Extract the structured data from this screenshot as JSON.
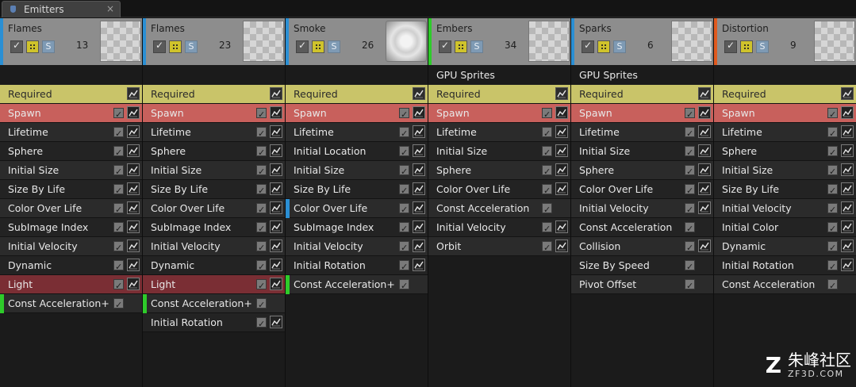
{
  "tab": {
    "title": "Emitters",
    "close_glyph": "×",
    "icon": "emitter-icon"
  },
  "colors": {
    "required": "#c9c469",
    "spawn": "#c8605c",
    "light": "#7a2e34",
    "enabled_marker": "#2ecb2a",
    "selected_marker": "#2a8fd4",
    "emitter_accent_blue": "#2a8fd4",
    "emitter_accent_green": "#2ecb2a",
    "emitter_accent_orange": "#e05a1f"
  },
  "emitters": [
    {
      "name": "Flames",
      "count": "13",
      "thumbnail": "checker",
      "accent": "blue",
      "subheader": "",
      "modules": [
        {
          "label": "Required",
          "type": "required"
        },
        {
          "label": "Spawn",
          "type": "spawn"
        },
        {
          "label": "Lifetime"
        },
        {
          "label": "Sphere"
        },
        {
          "label": "Initial Size"
        },
        {
          "label": "Size By Life"
        },
        {
          "label": "Color Over Life"
        },
        {
          "label": "SubImage Index"
        },
        {
          "label": "Initial Velocity"
        },
        {
          "label": "Dynamic"
        },
        {
          "label": "Light",
          "type": "light"
        },
        {
          "label": "Const Acceleration+",
          "marker": "green",
          "no_graph": true
        }
      ]
    },
    {
      "name": "Flames",
      "count": "23",
      "thumbnail": "checker",
      "accent": "blue",
      "subheader": "",
      "modules": [
        {
          "label": "Required",
          "type": "required"
        },
        {
          "label": "Spawn",
          "type": "spawn"
        },
        {
          "label": "Lifetime"
        },
        {
          "label": "Sphere"
        },
        {
          "label": "Initial Size"
        },
        {
          "label": "Size By Life"
        },
        {
          "label": "Color Over Life"
        },
        {
          "label": "SubImage Index"
        },
        {
          "label": "Initial Velocity"
        },
        {
          "label": "Dynamic"
        },
        {
          "label": "Light",
          "type": "light"
        },
        {
          "label": "Const Acceleration+",
          "marker": "green",
          "no_graph": true
        },
        {
          "label": "Initial Rotation"
        }
      ]
    },
    {
      "name": "Smoke",
      "count": "26",
      "thumbnail": "smoke",
      "accent": "blue",
      "subheader": "",
      "modules": [
        {
          "label": "Required",
          "type": "required"
        },
        {
          "label": "Spawn",
          "type": "spawn"
        },
        {
          "label": "Lifetime"
        },
        {
          "label": "Initial Location"
        },
        {
          "label": "Initial Size"
        },
        {
          "label": "Size By Life"
        },
        {
          "label": "Color Over Life",
          "marker": "blue"
        },
        {
          "label": "SubImage Index"
        },
        {
          "label": "Initial Velocity"
        },
        {
          "label": "Initial Rotation"
        },
        {
          "label": "Const Acceleration+",
          "marker": "green",
          "no_graph": true
        }
      ]
    },
    {
      "name": "Embers",
      "count": "34",
      "thumbnail": "checker",
      "accent": "green",
      "subheader": "GPU Sprites",
      "modules": [
        {
          "label": "Required",
          "type": "required"
        },
        {
          "label": "Spawn",
          "type": "spawn"
        },
        {
          "label": "Lifetime"
        },
        {
          "label": "Initial Size"
        },
        {
          "label": "Sphere"
        },
        {
          "label": "Color Over Life"
        },
        {
          "label": "Const Acceleration",
          "no_graph": true
        },
        {
          "label": "Initial Velocity"
        },
        {
          "label": "Orbit"
        }
      ]
    },
    {
      "name": "Sparks",
      "count": "6",
      "thumbnail": "checker",
      "accent": "blue",
      "subheader": "GPU Sprites",
      "modules": [
        {
          "label": "Required",
          "type": "required"
        },
        {
          "label": "Spawn",
          "type": "spawn"
        },
        {
          "label": "Lifetime"
        },
        {
          "label": "Initial Size"
        },
        {
          "label": "Sphere"
        },
        {
          "label": "Color Over Life"
        },
        {
          "label": "Initial Velocity"
        },
        {
          "label": "Const Acceleration",
          "no_graph": true
        },
        {
          "label": "Collision"
        },
        {
          "label": "Size By Speed",
          "no_graph": true
        },
        {
          "label": "Pivot Offset",
          "no_graph": true
        }
      ]
    },
    {
      "name": "Distortion",
      "count": "9",
      "thumbnail": "checker",
      "accent": "orange",
      "subheader": "",
      "modules": [
        {
          "label": "Required",
          "type": "required"
        },
        {
          "label": "Spawn",
          "type": "spawn"
        },
        {
          "label": "Lifetime"
        },
        {
          "label": "Sphere"
        },
        {
          "label": "Initial Size"
        },
        {
          "label": "Size By Life"
        },
        {
          "label": "Initial Velocity"
        },
        {
          "label": "Initial Color"
        },
        {
          "label": "Dynamic"
        },
        {
          "label": "Initial Rotation"
        },
        {
          "label": "Const Acceleration",
          "no_graph": true
        }
      ]
    }
  ],
  "watermark": {
    "logo": "Z",
    "text_cn": "朱峰社区",
    "url": "ZF3D.COM"
  }
}
